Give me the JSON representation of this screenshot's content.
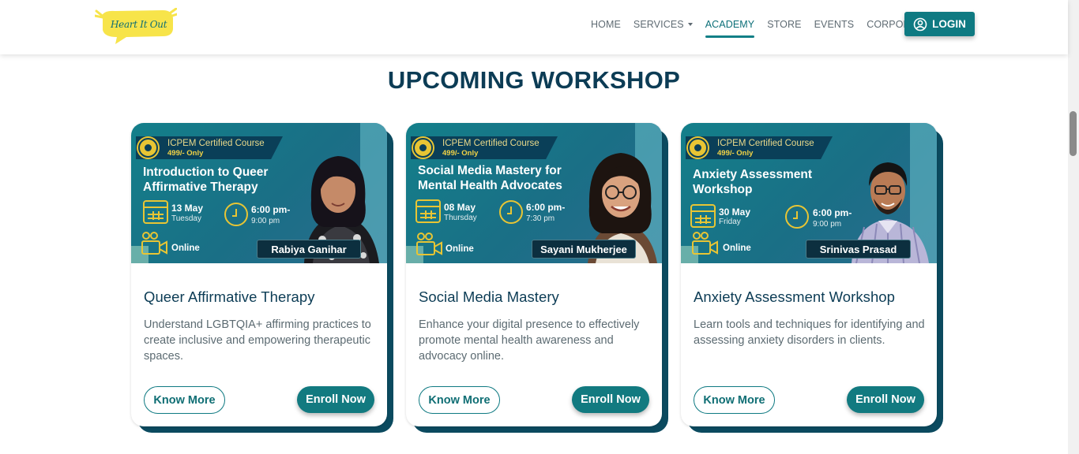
{
  "header": {
    "logo_text": "Heart It Out",
    "nav": [
      {
        "label": "HOME"
      },
      {
        "label": "SERVICES"
      },
      {
        "label": "ACADEMY"
      },
      {
        "label": "STORE"
      },
      {
        "label": "EVENTS"
      },
      {
        "label": "CORPORATE"
      }
    ],
    "active_nav": "ACADEMY",
    "login_label": "LOGIN"
  },
  "section_title": "UPCOMING WORKSHOP",
  "colors": {
    "brand_teal": "#127a80",
    "navy": "#0c3c55",
    "card_shadow": "#0b4a5f",
    "logo_yellow": "#f7e44a"
  },
  "cards": [
    {
      "banner": {
        "cert": "ICPEM  Certified Course",
        "price": "499/- Only",
        "title": "Introduction to Queer Affirmative Therapy",
        "date": "13 May",
        "day": "Tuesday",
        "time": "6:00 pm-",
        "time_end": "9:00 pm",
        "mode": "Online",
        "speaker": "Rabiya Ganihar"
      },
      "title": "Queer Affirmative Therapy",
      "description": "Understand LGBTQIA+ affirming practices to create inclusive and empowering therapeutic spaces.",
      "know_more": "Know More",
      "enroll": "Enroll Now"
    },
    {
      "banner": {
        "cert": "ICPEM  Certified Course",
        "price": "499/- Only",
        "title": "Social Media Mastery for Mental Health Advocates",
        "date": "08 May",
        "day": "Thursday",
        "time": "6:00 pm-",
        "time_end": "7:30 pm",
        "mode": "Online",
        "speaker": "Sayani Mukherjee"
      },
      "title": "Social Media Mastery",
      "description": "Enhance your digital presence to effectively promote mental health awareness and advocacy online.",
      "know_more": "Know More",
      "enroll": "Enroll Now"
    },
    {
      "banner": {
        "cert": "ICPEM  Certified Course",
        "price": "499/- Only",
        "title": "Anxiety Assessment Workshop",
        "date": "30 May",
        "day": "Friday",
        "time": "6:00 pm-",
        "time_end": "9:00 pm",
        "mode": "Online",
        "speaker": "Srinivas Prasad"
      },
      "title": "Anxiety Assessment Workshop",
      "description": "Learn tools and techniques for identifying and assessing anxiety disorders in clients.",
      "know_more": "Know More",
      "enroll": "Enroll Now"
    }
  ]
}
